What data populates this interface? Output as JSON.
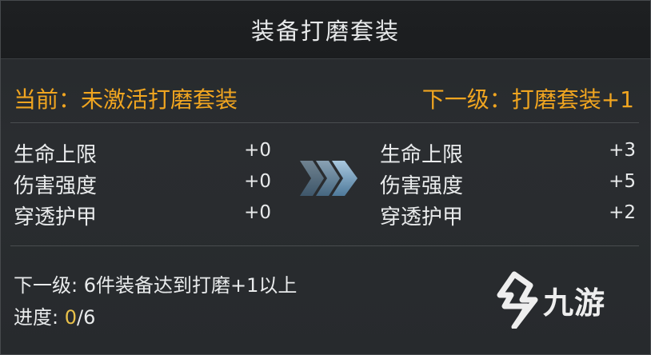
{
  "header": {
    "title": "装备打磨套装"
  },
  "status": {
    "current_label": "当前：未激活打磨套装",
    "next_label": "下一级：打磨套装+1"
  },
  "current_stats": [
    {
      "name": "生命上限",
      "value": "+0"
    },
    {
      "name": "伤害强度",
      "value": "+0"
    },
    {
      "name": "穿透护甲",
      "value": "+0"
    }
  ],
  "next_stats": [
    {
      "name": "生命上限",
      "value": "+3"
    },
    {
      "name": "伤害强度",
      "value": "+5"
    },
    {
      "name": "穿透护甲",
      "value": "+2"
    }
  ],
  "footer": {
    "requirement": "下一级: 6件装备达到打磨+1以上",
    "progress_label": "进度: ",
    "progress_current": "0",
    "progress_total": "/6"
  },
  "watermark": {
    "text": "九游"
  },
  "colors": {
    "accent_gold": "#f0a520",
    "progress_yellow": "#e9c14a",
    "arrow_blue": "#7fa9c9"
  }
}
